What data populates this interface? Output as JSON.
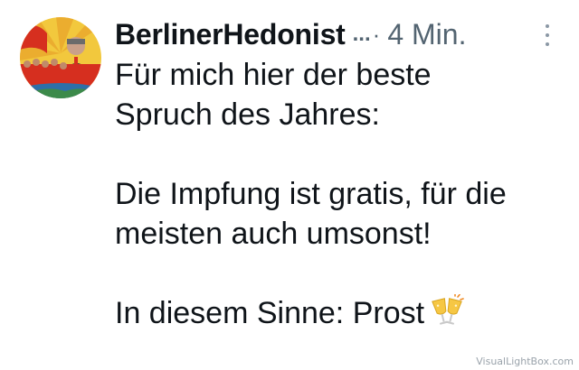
{
  "tweet": {
    "author": "BerlinerHedonist",
    "ellipsis": "...",
    "separator": "·",
    "time": "4 Min.",
    "lines": [
      "Für mich hier der beste",
      "Spruch des Jahres:",
      "Die Impfung ist gratis, für die",
      "meisten auch umsonst!",
      "In diesem Sinne: Prost"
    ],
    "emoji_icon": "clinking-glasses-icon",
    "more_icon": "more-vertical-icon"
  },
  "watermark": "VisualLightBox.com",
  "colors": {
    "text": "#0f1419",
    "muted": "#536471",
    "avatar_red": "#d62f1f",
    "avatar_yellow": "#f3c23b"
  }
}
